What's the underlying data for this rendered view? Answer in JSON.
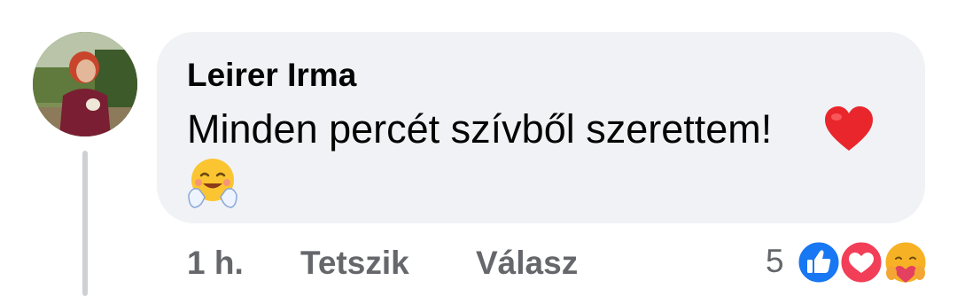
{
  "comment": {
    "author": "Leirer Irma",
    "text": "Minden percét szívből szerettem!",
    "emojis": [
      "heart-emoji",
      "hugging-face-emoji"
    ]
  },
  "meta": {
    "time": "1 h.",
    "like_label": "Tetszik",
    "reply_label": "Válasz"
  },
  "reactions": {
    "count": "5",
    "types": [
      "like-icon",
      "love-icon",
      "care-icon"
    ]
  },
  "colors": {
    "bubble": "#f0f2f5",
    "like": "#1877f2",
    "love": "#f33e58",
    "care": "#f7b125",
    "meta_text": "#65676b"
  }
}
